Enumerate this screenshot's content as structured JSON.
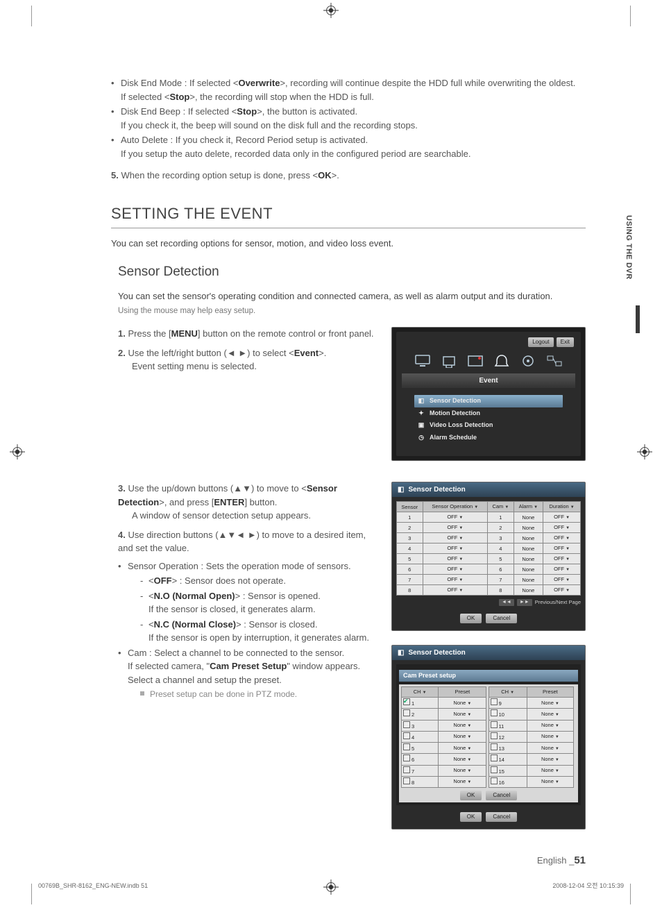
{
  "top_section": {
    "bullets": [
      {
        "strong1": "Overwrite",
        "line1a": "Disk End Mode : If selected <",
        "line1b": ">, recording will continue despite the HDD full while overwriting the oldest.",
        "line2a": "If selected <",
        "strong2": "Stop",
        "line2b": ">, the recording will stop when the HDD is full."
      },
      {
        "line1a": "Disk End Beep : If selected <",
        "strong1": "Stop",
        "line1b": ">, the button is activated.",
        "line2": "If you check it, the beep will sound on the disk full and the recording stops."
      },
      {
        "line1": "Auto Delete : If you check it, Record Period setup is activated.",
        "line2": "If you setup the auto delete, recorded data only in the configured period are searchable."
      }
    ],
    "step5_num": "5.",
    "step5_a": "When the recording option setup is done, press <",
    "step5_strong": "OK",
    "step5_b": ">."
  },
  "setting_event": {
    "title": "SETTING THE EVENT",
    "intro": "You can set recording options for sensor, motion, and video loss event."
  },
  "sensor_section": {
    "title": "Sensor Detection",
    "intro": "You can set the sensor's operating condition and connected camera, as well as alarm output and its duration.",
    "note": "Using the mouse may help easy setup.",
    "step1_num": "1.",
    "step1_a": "Press the [",
    "step1_strong": "MENU",
    "step1_b": "] button on the remote control or front panel.",
    "step2_num": "2.",
    "step2_a": "Use the left/right button (◄ ►) to select <",
    "step2_strong": "Event",
    "step2_b": ">.",
    "step2_l2": "Event setting menu is selected.",
    "step3_num": "3.",
    "step3_a": "Use the up/down buttons (▲▼) to move to <",
    "step3_strong": "Sensor Detection",
    "step3_b": ">, and press [",
    "step3_strong2": "ENTER",
    "step3_c": "] button.",
    "step3_l2": "A window of sensor detection setup appears.",
    "step4_num": "4.",
    "step4": "Use direction buttons (▲▼◄ ►) to move to a desired item, and set the value.",
    "b1": "Sensor Operation : Sets the operation mode of sensors.",
    "b1s1_a": "<",
    "b1s1_strong": "OFF",
    "b1s1_b": "> : Sensor does not operate.",
    "b1s2_a": "<",
    "b1s2_strong": "N.O (Normal Open)",
    "b1s2_b": "> : Sensor is opened.",
    "b1s2_l2": "If the sensor is closed, it generates alarm.",
    "b1s3_a": "<",
    "b1s3_strong": "N.C (Normal Close)",
    "b1s3_b": "> : Sensor is closed.",
    "b1s3_l2": "If the sensor is open by interruption, it generates alarm.",
    "b2_l1": "Cam : Select a channel to be connected to the sensor.",
    "b2_l2a": "If selected camera, \"",
    "b2_l2_strong": "Cam Preset Setup",
    "b2_l2b": "\" window appears.",
    "b2_l3": "Select a channel and setup the preset.",
    "b2_sq": "Preset setup can be done in PTZ mode."
  },
  "side_tab": "USING THE DVR",
  "ui_event": {
    "logout": "Logout",
    "exit": "Exit",
    "tab": "Event",
    "items": [
      "Sensor Detection",
      "Motion Detection",
      "Video Loss Detection",
      "Alarm Schedule"
    ]
  },
  "ui_sensor_table": {
    "title": "Sensor Detection",
    "headers": [
      "Sensor",
      "Sensor Operation",
      "Cam",
      "Alarm",
      "Duration"
    ],
    "rows": [
      {
        "n": "1",
        "op": "OFF",
        "cam": "1",
        "alarm": "None",
        "dur": "OFF"
      },
      {
        "n": "2",
        "op": "OFF",
        "cam": "2",
        "alarm": "None",
        "dur": "OFF"
      },
      {
        "n": "3",
        "op": "OFF",
        "cam": "3",
        "alarm": "None",
        "dur": "OFF"
      },
      {
        "n": "4",
        "op": "OFF",
        "cam": "4",
        "alarm": "None",
        "dur": "OFF"
      },
      {
        "n": "5",
        "op": "OFF",
        "cam": "5",
        "alarm": "None",
        "dur": "OFF"
      },
      {
        "n": "6",
        "op": "OFF",
        "cam": "6",
        "alarm": "None",
        "dur": "OFF"
      },
      {
        "n": "7",
        "op": "OFF",
        "cam": "7",
        "alarm": "None",
        "dur": "OFF"
      },
      {
        "n": "8",
        "op": "OFF",
        "cam": "8",
        "alarm": "None",
        "dur": "OFF"
      }
    ],
    "pager": "Previous/Next Page",
    "ok": "OK",
    "cancel": "Cancel"
  },
  "ui_preset": {
    "outer_title": "Sensor Detection",
    "inner_title": "Cam Preset setup",
    "h_ch": "CH",
    "h_preset": "Preset",
    "left": [
      {
        "c": "1",
        "p": "None",
        "ck": true
      },
      {
        "c": "2",
        "p": "None"
      },
      {
        "c": "3",
        "p": "None"
      },
      {
        "c": "4",
        "p": "None"
      },
      {
        "c": "5",
        "p": "None"
      },
      {
        "c": "6",
        "p": "None"
      },
      {
        "c": "7",
        "p": "None"
      },
      {
        "c": "8",
        "p": "None"
      }
    ],
    "right": [
      {
        "c": "9",
        "p": "None"
      },
      {
        "c": "10",
        "p": "None"
      },
      {
        "c": "11",
        "p": "None"
      },
      {
        "c": "12",
        "p": "None"
      },
      {
        "c": "13",
        "p": "None"
      },
      {
        "c": "14",
        "p": "None"
      },
      {
        "c": "15",
        "p": "None"
      },
      {
        "c": "16",
        "p": "None"
      }
    ],
    "ok": "OK",
    "cancel": "Cancel"
  },
  "page_label": "English _",
  "page_num": "51",
  "foot_left": "00769B_SHR-8162_ENG-NEW.indb   51",
  "foot_right": "2008-12-04   오전 10:15:39"
}
